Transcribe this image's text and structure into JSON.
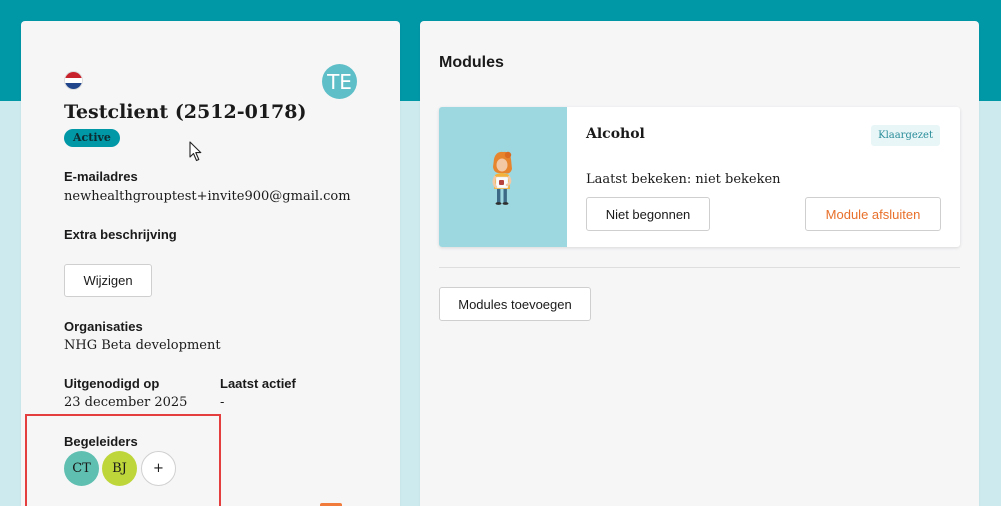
{
  "client": {
    "name": "Testclient (2512-0178)",
    "status": "Active",
    "avatar_initials": "TE",
    "flag": "netherlands-flag-icon"
  },
  "details": {
    "email_label": "E-mailadres",
    "email_value": "newhealthgrouptest+invite900@gmail.com",
    "extra_label": "Extra beschrijving",
    "edit_button": "Wijzigen",
    "org_label": "Organisaties",
    "org_value": "NHG Beta development",
    "invited_label": "Uitgenodigd op",
    "invited_value": "23 december 2025",
    "last_active_label": "Laatst actief",
    "last_active_value": "-",
    "guides_label": "Begeleiders",
    "guides": [
      {
        "initials": "CT",
        "color": "#5fbfb0"
      },
      {
        "initials": "BJ",
        "color": "#bfd63a"
      }
    ],
    "add_guide_label": "+"
  },
  "modules": {
    "title": "Modules",
    "items": [
      {
        "name": "Alcohol",
        "badge": "Klaargezet",
        "last_seen": "Laatst bekeken: niet bekeken",
        "status_button": "Niet begonnen",
        "close_button": "Module afsluiten"
      }
    ],
    "add_button": "Modules toevoegen"
  },
  "colors": {
    "brand_teal": "#0097a7",
    "page_bg": "#cdebee",
    "accent_orange": "#f07b3b",
    "highlight_red": "#e53e3e"
  }
}
